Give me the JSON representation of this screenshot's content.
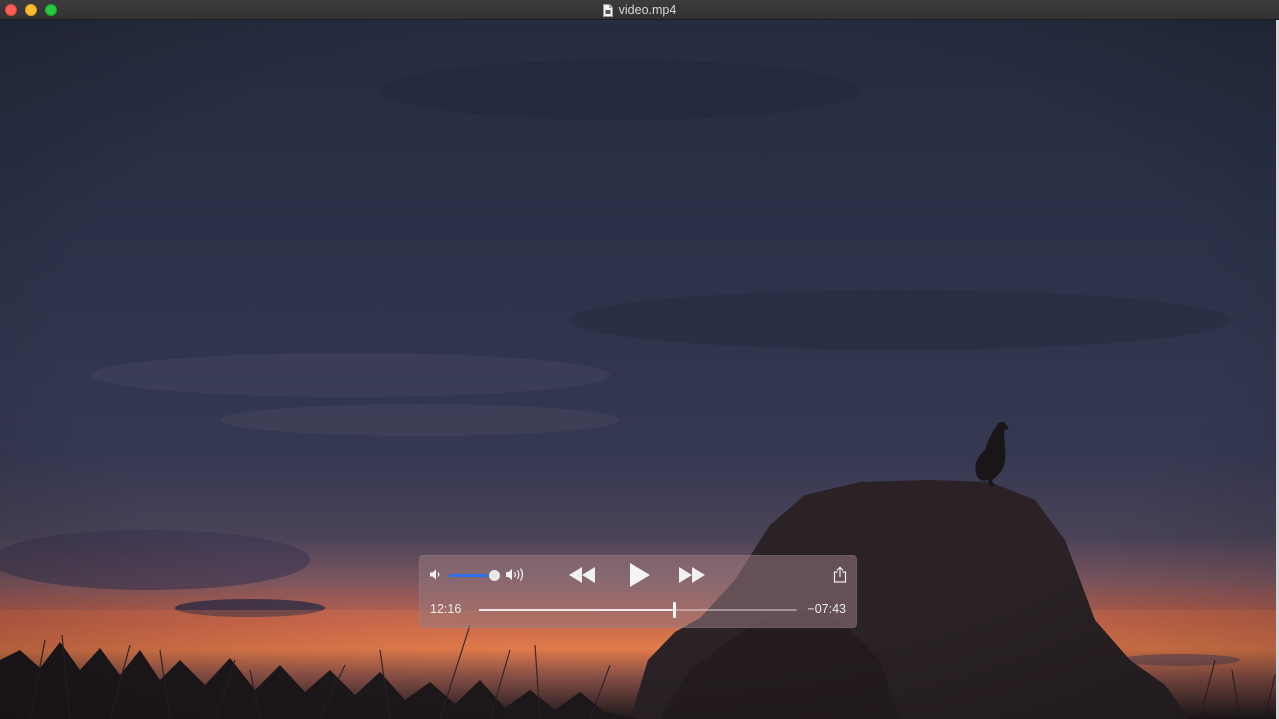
{
  "window": {
    "title": "video.mp4",
    "traffic_lights": {
      "close": "#fe5f57",
      "minimize": "#febc2e",
      "zoom": "#28c840"
    }
  },
  "player": {
    "elapsed": "12:16",
    "remaining": "−07:43",
    "progress": 0.612,
    "volume": 0.95,
    "volume_accent": "#2f6fe8",
    "state": "paused",
    "icons": [
      "volume-low-icon",
      "volume-high-icon",
      "rewind-icon",
      "play-icon",
      "fast-forward-icon",
      "share-icon"
    ]
  }
}
